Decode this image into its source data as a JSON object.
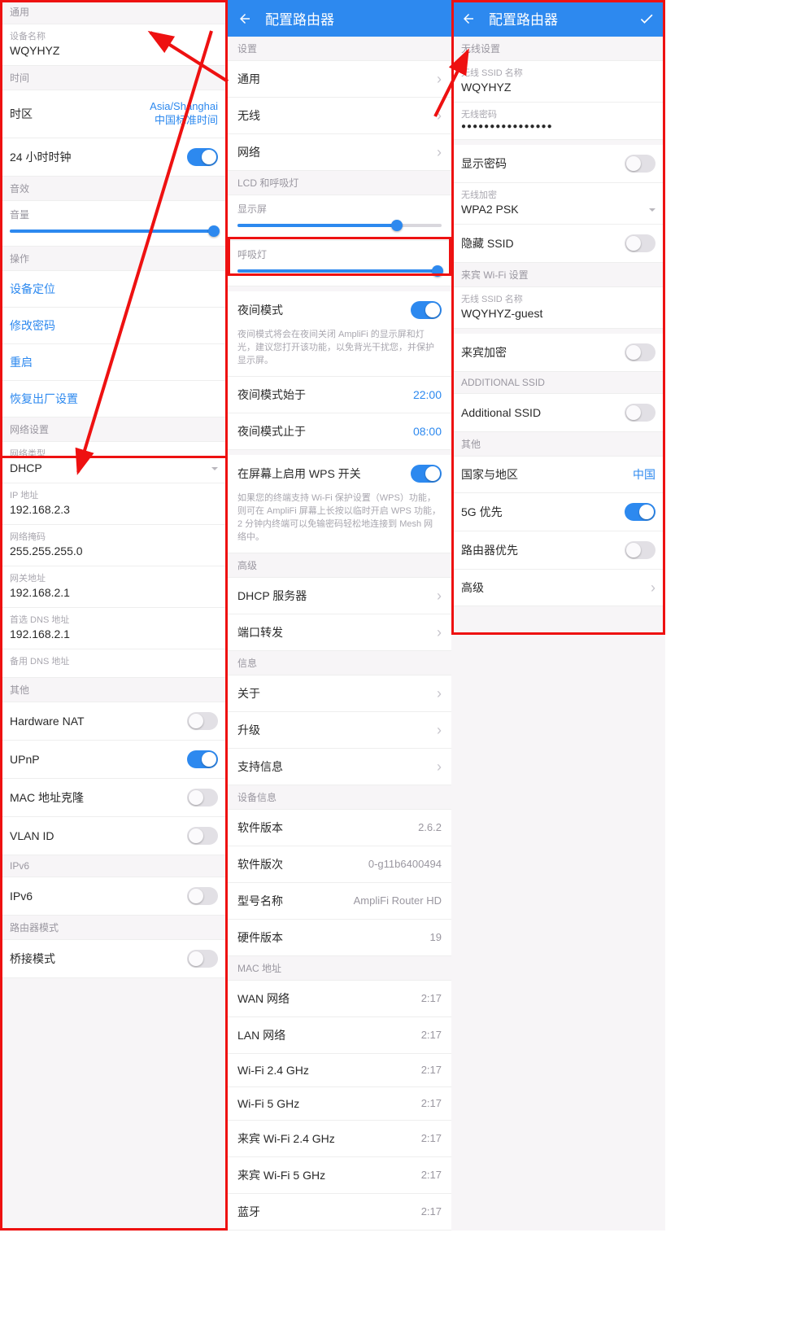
{
  "colors": {
    "accent": "#2d89ef",
    "anno": "#e11"
  },
  "p1": {
    "sec_general": "通用",
    "device_name_lbl": "设备名称",
    "device_name": "WQYHYZ",
    "sec_time": "时间",
    "timezone_lbl": "时区",
    "timezone_v1": "Asia/Shanghai",
    "timezone_v2": "中国标准时间",
    "clock24_lbl": "24 小时时钟",
    "sec_sound": "音效",
    "volume_lbl": "音量",
    "sec_ops": "操作",
    "op_locate": "设备定位",
    "op_chpwd": "修改密码",
    "op_reboot": "重启",
    "op_factory": "恢复出厂设置",
    "sec_net": "网络设置",
    "net_type_lbl": "网络类型",
    "net_type": "DHCP",
    "ip_lbl": "IP 地址",
    "ip": "192.168.2.3",
    "mask_lbl": "网络掩码",
    "mask": "255.255.255.0",
    "gw_lbl": "网关地址",
    "gw": "192.168.2.1",
    "dns1_lbl": "首选 DNS 地址",
    "dns1": "192.168.2.1",
    "dns2_lbl": "备用 DNS 地址",
    "dns2": "",
    "sec_other": "其他",
    "hwnat": "Hardware NAT",
    "upnp": "UPnP",
    "maccl": "MAC 地址克隆",
    "vlan": "VLAN ID",
    "sec_ipv6": "IPv6",
    "ipv6": "IPv6",
    "sec_mode": "路由器模式",
    "bridge": "桥接模式"
  },
  "p2": {
    "title": "配置路由器",
    "sec_set": "设置",
    "m_general": "通用",
    "m_wireless": "无线",
    "m_network": "网络",
    "sec_lcd": "LCD 和呼吸灯",
    "disp_lbl": "显示屏",
    "led_lbl": "呼吸灯",
    "night_lbl": "夜间模式",
    "night_desc": "夜间模式将会在夜间关闭 AmpliFi 的显示屏和灯光，建议您打开该功能，以免背光干扰您，并保护显示屏。",
    "night_from_lbl": "夜间模式始于",
    "night_from": "22:00",
    "night_to_lbl": "夜间模式止于",
    "night_to": "08:00",
    "wps_lbl": "在屏幕上启用 WPS 开关",
    "wps_desc": "如果您的终端支持 Wi-Fi 保护设置（WPS）功能，则可在 AmpliFi 屏幕上长按以临时开启 WPS 功能，2 分钟内终端可以免输密码轻松地连接到 Mesh 网络中。",
    "sec_adv": "高级",
    "dhcp_srv": "DHCP 服务器",
    "port_fwd": "端口转发",
    "sec_info": "信息",
    "about": "关于",
    "upgrade": "升级",
    "support": "支持信息",
    "sec_devinfo": "设备信息",
    "sw_ver_lbl": "软件版本",
    "sw_ver": "2.6.2",
    "sw_rev_lbl": "软件版次",
    "sw_rev": "0-g11b6400494",
    "model_lbl": "型号名称",
    "model": "AmpliFi Router HD",
    "hw_ver_lbl": "硬件版本",
    "hw_ver": "19",
    "sec_mac": "MAC 地址",
    "mac_rows": [
      {
        "lbl": "WAN 网络",
        "val": "2:17"
      },
      {
        "lbl": "LAN 网络",
        "val": "2:17"
      },
      {
        "lbl": "Wi-Fi 2.4 GHz",
        "val": "2:17"
      },
      {
        "lbl": "Wi-Fi 5 GHz",
        "val": "2:17"
      },
      {
        "lbl": "来宾 Wi-Fi 2.4 GHz",
        "val": "2:17"
      },
      {
        "lbl": "来宾 Wi-Fi 5 GHz",
        "val": "2:17"
      },
      {
        "lbl": "蓝牙",
        "val": "2:17"
      }
    ]
  },
  "p3": {
    "title": "配置路由器",
    "sec_wl": "无线设置",
    "ssid_lbl": "无线 SSID 名称",
    "ssid": "WQYHYZ",
    "pwd_lbl": "无线密码",
    "pwd_mask": "●●●●●●●●●●●●●●●●",
    "show_pwd": "显示密码",
    "enc_lbl": "无线加密",
    "enc": "WPA2 PSK",
    "hide_ssid": "隐藏 SSID",
    "sec_guest": "来宾 Wi-Fi 设置",
    "gssid_lbl": "无线 SSID 名称",
    "gssid": "WQYHYZ-guest",
    "g_enc": "来宾加密",
    "sec_add": "ADDITIONAL SSID",
    "add_ssid": "Additional SSID",
    "sec_other": "其他",
    "country_lbl": "国家与地区",
    "country": "中国",
    "fiveg": "5G 优先",
    "router_pri": "路由器优先",
    "adv": "高级"
  }
}
